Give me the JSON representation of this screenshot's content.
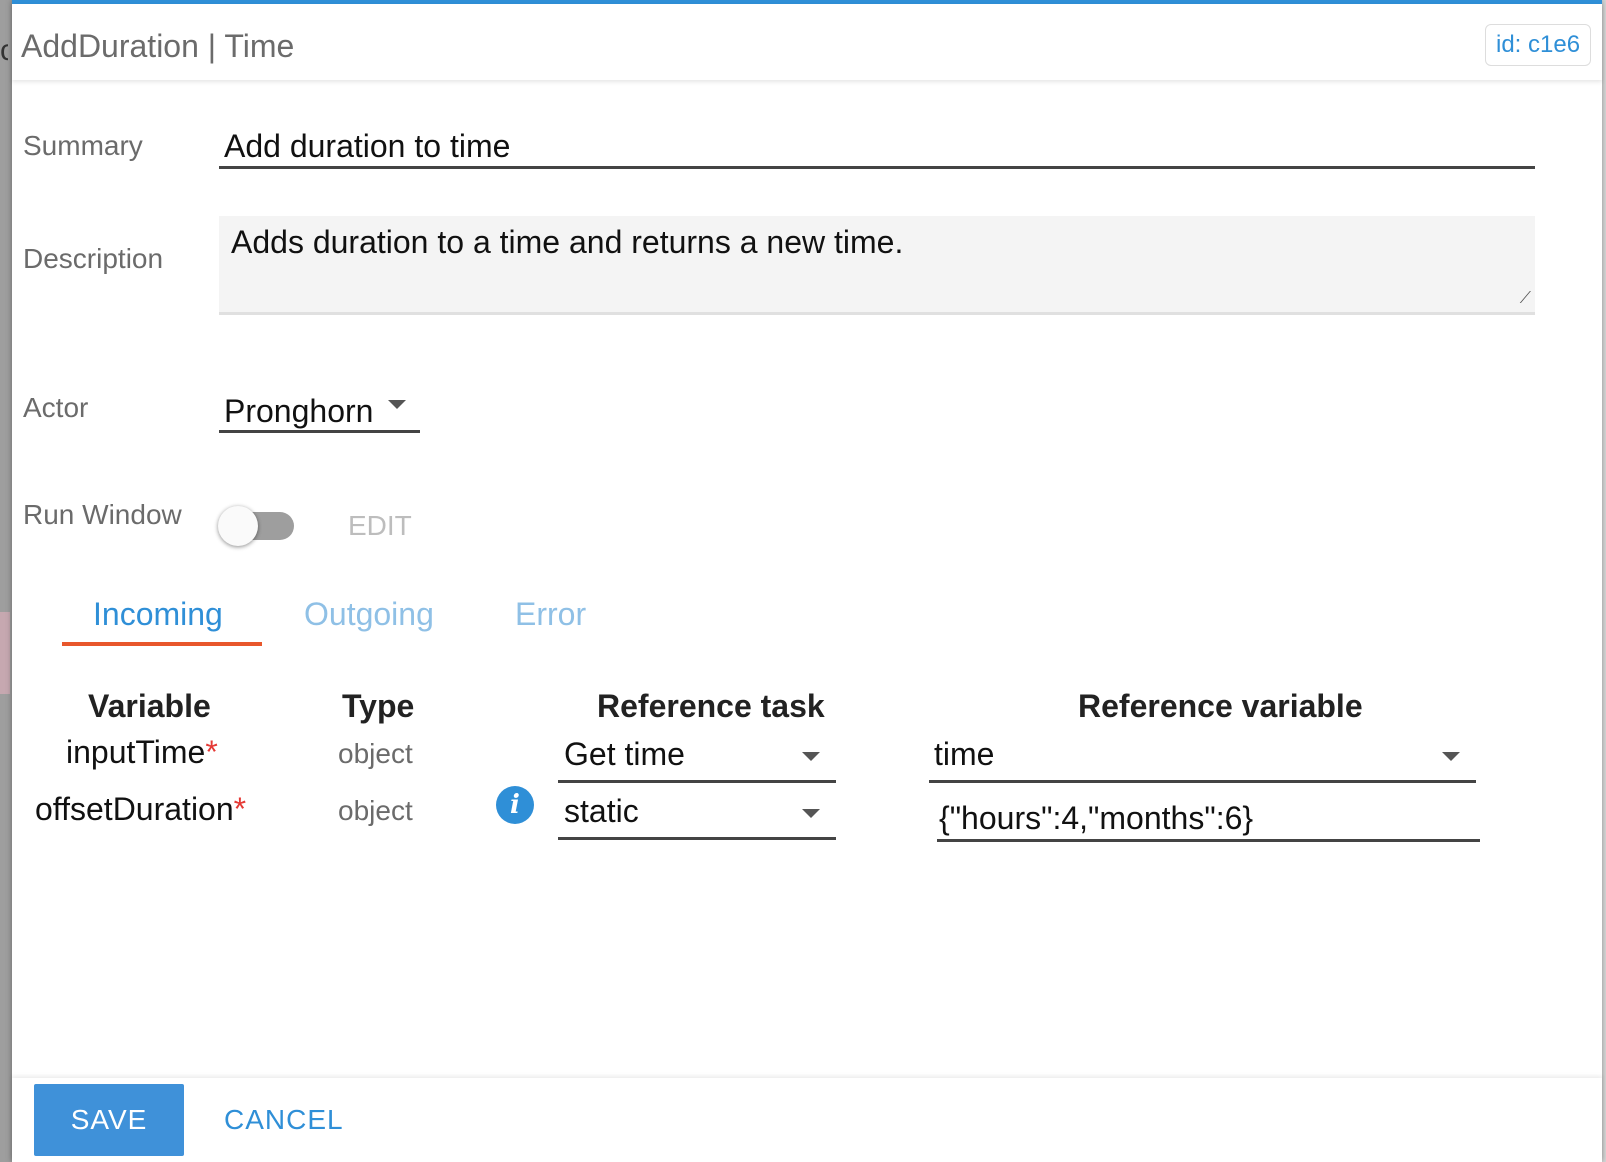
{
  "header": {
    "title": "AddDuration | Time",
    "id_badge": "id: c1e6"
  },
  "form": {
    "summary": {
      "label": "Summary",
      "value": "Add duration to time"
    },
    "description": {
      "label": "Description",
      "value": "Adds duration to a time and returns a new time."
    },
    "actor": {
      "label": "Actor",
      "value": "Pronghorn"
    },
    "run_window": {
      "label": "Run Window",
      "enabled": false,
      "edit_label": "EDIT"
    }
  },
  "tabs": [
    {
      "label": "Incoming",
      "active": true
    },
    {
      "label": "Outgoing",
      "active": false
    },
    {
      "label": "Error",
      "active": false
    }
  ],
  "table": {
    "headers": [
      "Variable",
      "Type",
      "Reference task",
      "Reference variable"
    ],
    "rows": [
      {
        "variable": "inputTime",
        "required": "*",
        "type": "object",
        "reference_task": "Get time",
        "reference_variable": "time",
        "info_icon": false
      },
      {
        "variable": "offsetDuration",
        "required": "*",
        "type": "object",
        "reference_task": "static",
        "reference_variable": "{\"hours\":4,\"months\":6}",
        "info_icon": true
      }
    ]
  },
  "footer": {
    "save_label": "SAVE",
    "cancel_label": "CANCEL"
  },
  "colors": {
    "accent": "#2f8fd7",
    "tab_underline": "#e8572c",
    "required": "#e53935"
  }
}
